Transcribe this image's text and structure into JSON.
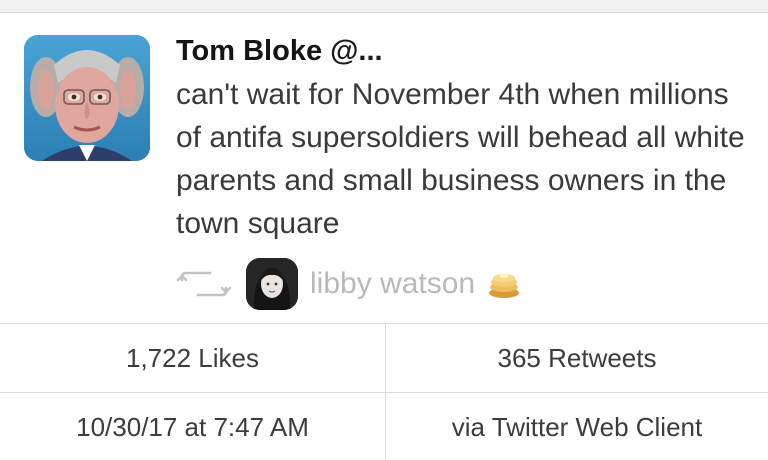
{
  "tweet": {
    "author_name": "Tom Bloke",
    "author_handle": "@...",
    "text": "can't wait for November 4th when millions of antifa supersoldiers will behead all white parents and small business owners in the town square",
    "avatar_icon": "caricature-avatar",
    "retweet_icon": "retweet-icon",
    "retweeted_by": "libby watson",
    "retweeter_emoji": "pancakes-icon"
  },
  "stats": {
    "likes": "1,722 Likes",
    "retweets": "365 Retweets",
    "timestamp": "10/30/17 at 7:47 AM",
    "client": "via Twitter Web Client"
  },
  "colors": {
    "text_primary": "#141414",
    "text_body": "#3a3a3a",
    "text_muted": "#b9b9b9",
    "divider": "#dcdcdc"
  }
}
